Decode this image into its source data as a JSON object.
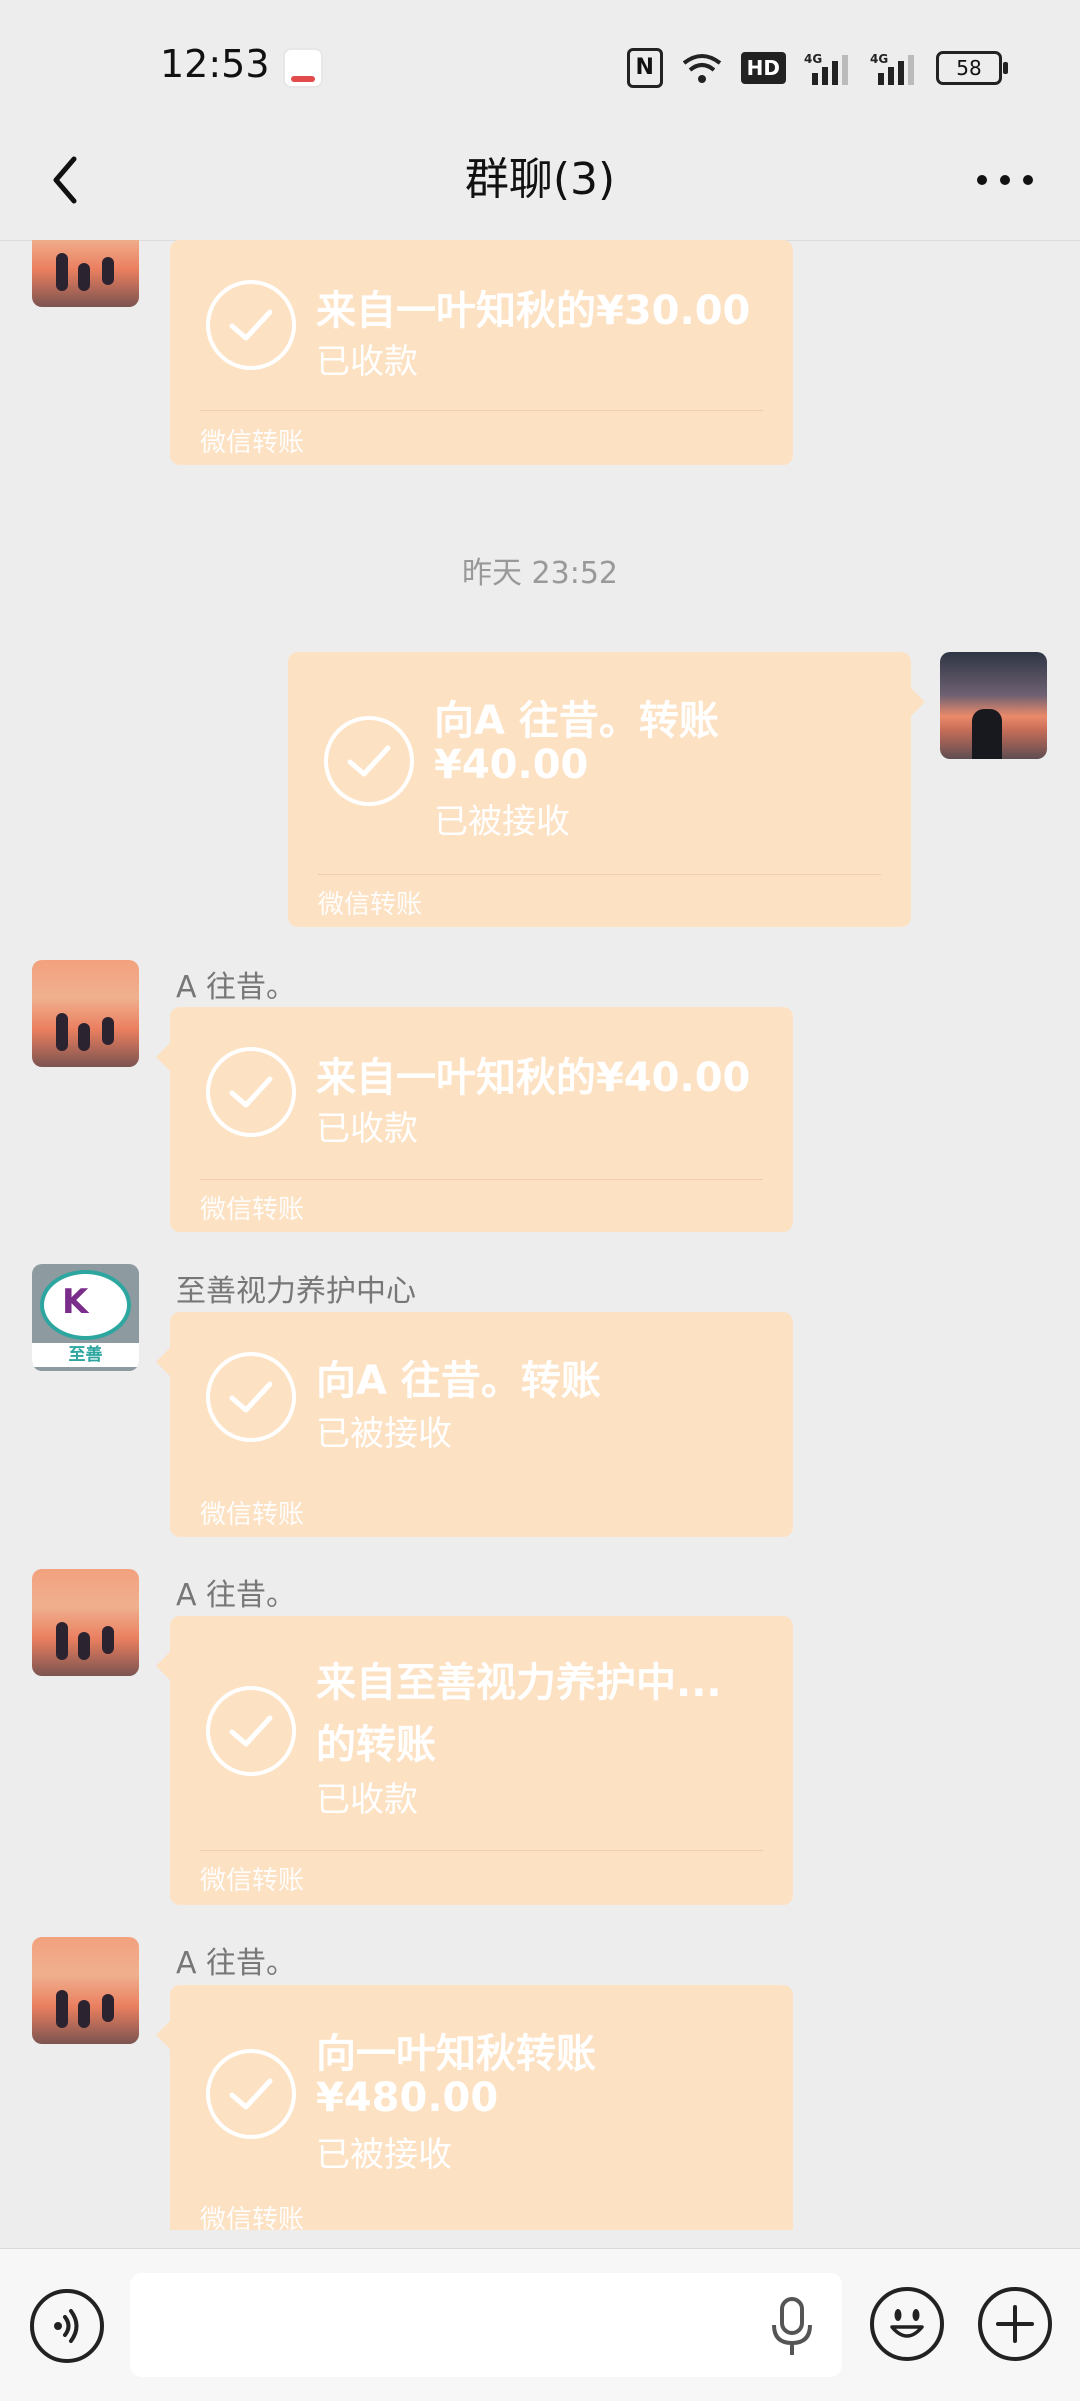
{
  "status_bar": {
    "time": "12:53",
    "hd_label": "HD",
    "nfc_label": "N",
    "battery": "58"
  },
  "header": {
    "title": "群聊(3)"
  },
  "messages": [
    {
      "side": "left",
      "title": "来自一叶知秋的¥30.00",
      "status": "已收款",
      "footer": "微信转账"
    },
    {
      "type": "timestamp",
      "text": "昨天 23:52"
    },
    {
      "side": "right",
      "title": "向A   往昔。转账",
      "amount": "¥40.00",
      "status": "已被接收",
      "footer": "微信转账"
    },
    {
      "side": "left",
      "sender": "A   往昔。",
      "title": "来自一叶知秋的¥40.00",
      "status": "已收款",
      "footer": "微信转账"
    },
    {
      "side": "left",
      "sender": "至善视力养护中心",
      "title": "向A   往昔。转账",
      "status": "已被接收",
      "footer": "微信转账",
      "avatar_text": "至善"
    },
    {
      "side": "left",
      "sender": "A   往昔。",
      "title": "来自至善视力养护中...",
      "title_line2": "的转账",
      "status": "已收款",
      "footer": "微信转账"
    },
    {
      "side": "left",
      "sender": "A   往昔。",
      "title": "向一叶知秋转账",
      "amount": "¥480.00",
      "status": "已被接收",
      "footer": "微信转账"
    }
  ],
  "input": {
    "value": "",
    "placeholder": ""
  },
  "colors": {
    "background": "#ededed",
    "bubble": "#fde1c3",
    "text_on_bubble": "#ffffff"
  },
  "icons": [
    "back-icon",
    "more-icon",
    "check-icon",
    "voice-icon",
    "mic-icon",
    "emoji-icon",
    "plus-icon"
  ]
}
